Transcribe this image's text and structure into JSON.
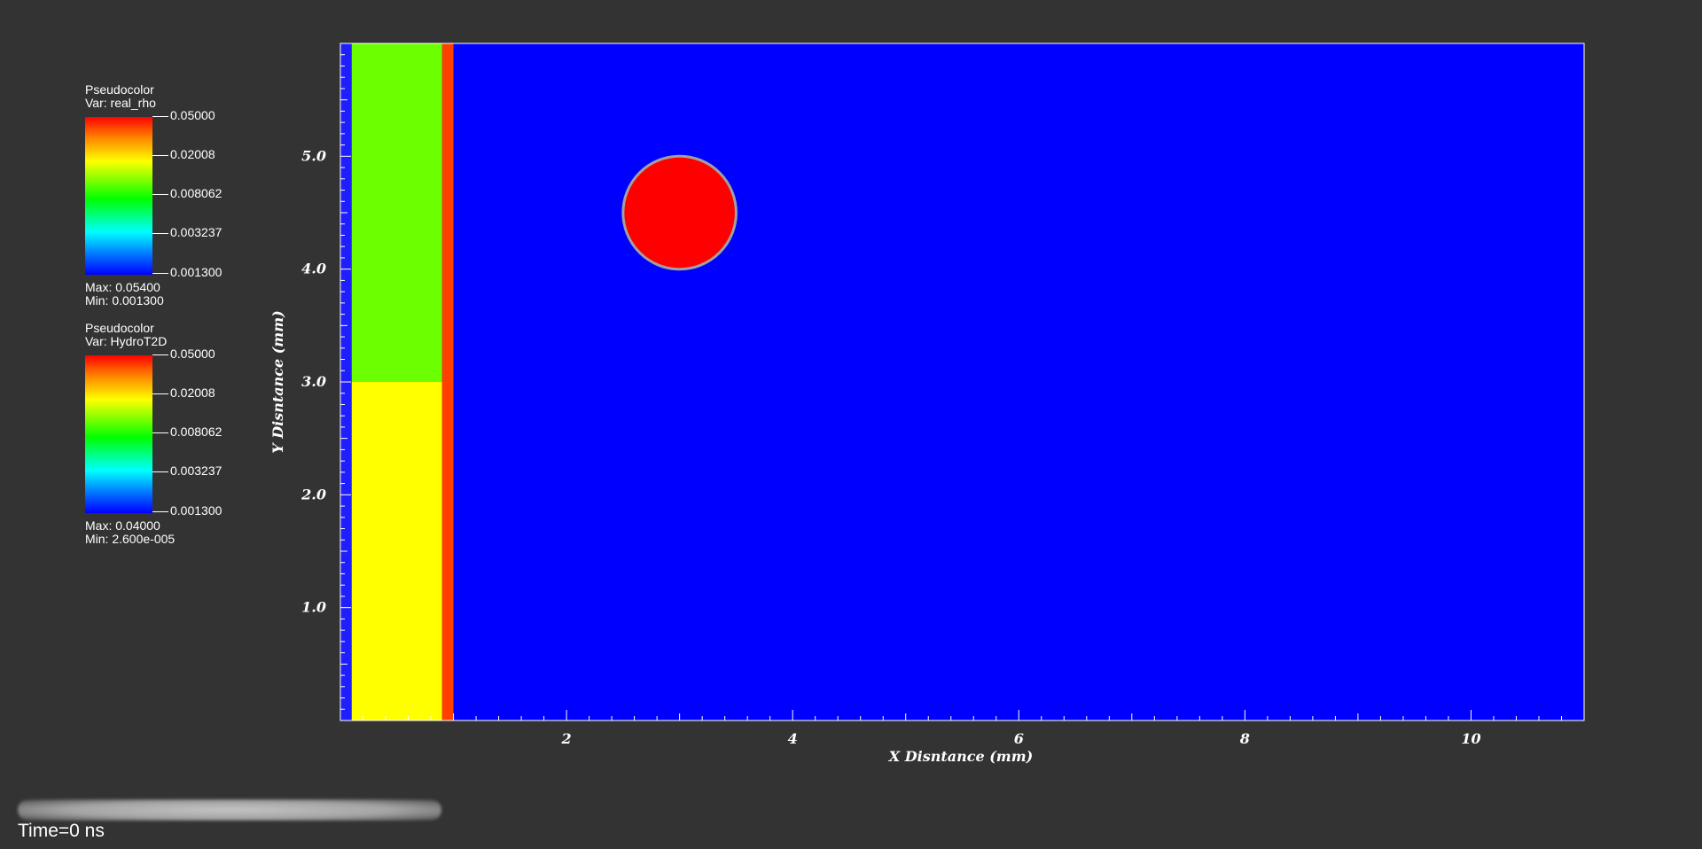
{
  "legends": [
    {
      "title": "Pseudocolor",
      "var": "Var: real_rho",
      "ticks": [
        "0.05000",
        "0.02008",
        "0.008062",
        "0.003237",
        "0.001300"
      ],
      "max": "Max:  0.05400",
      "min": "Min:  0.001300"
    },
    {
      "title": "Pseudocolor",
      "var": "Var: HydroT2D",
      "ticks": [
        "0.05000",
        "0.02008",
        "0.008062",
        "0.003237",
        "0.001300"
      ],
      "max": "Max:  0.04000",
      "min": "Min:  2.600e-005"
    }
  ],
  "plot": {
    "xlabel": "X Disntance (mm)",
    "ylabel": "Y Disntance (mm)",
    "xticks": [
      "2",
      "4",
      "6",
      "8",
      "10"
    ],
    "yticks": [
      "1.0",
      "2.0",
      "3.0",
      "4.0",
      "5.0"
    ],
    "xlim": [
      0.0,
      11.0
    ],
    "ylim": [
      0.0,
      6.0
    ],
    "regions": [
      {
        "name": "left-edge-strip",
        "x0": 0.0,
        "x1": 0.1,
        "y0": 0.0,
        "y1": 6.0,
        "color": "#1e1eff"
      },
      {
        "name": "green-upper-block",
        "x0": 0.1,
        "x1": 0.9,
        "y0": 3.0,
        "y1": 6.0,
        "color": "#6cff00"
      },
      {
        "name": "yellow-lower-block",
        "x0": 0.1,
        "x1": 0.9,
        "y0": 0.0,
        "y1": 3.0,
        "color": "#ffff00"
      },
      {
        "name": "orange-strip",
        "x0": 0.9,
        "x1": 1.0,
        "y0": 0.0,
        "y1": 6.0,
        "color": "#ff4000"
      }
    ],
    "circle": {
      "cx": 3.0,
      "cy": 4.5,
      "r": 0.5,
      "fill": "#ff0000",
      "stroke": "#a0a0a0"
    },
    "background_color": "#0000ff",
    "border_color": "#ffffff"
  },
  "time_label": "Time=0 ns"
}
